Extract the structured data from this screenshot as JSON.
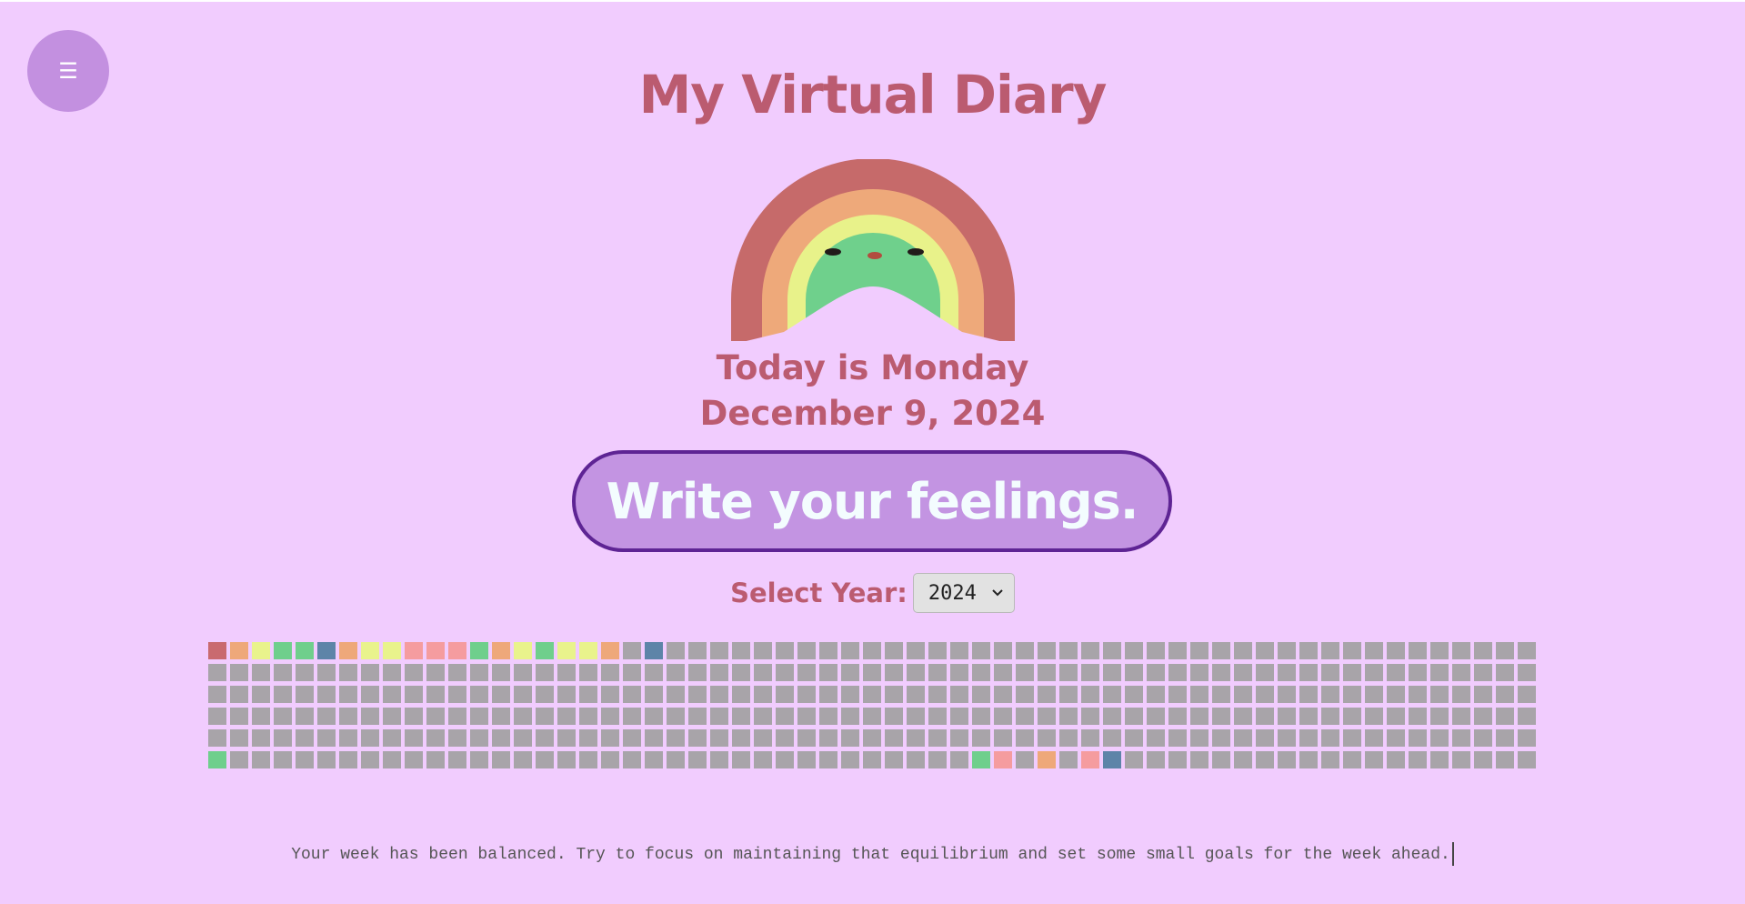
{
  "header": {
    "menu_label": "☰",
    "title": "My Virtual Diary"
  },
  "mascot": {
    "icon": "rainbow-face-icon"
  },
  "today": {
    "day_text": "Today is Monday",
    "date_text": "December 9, 2024"
  },
  "write_button_label": "Write your feelings.",
  "year_select": {
    "label": "Select Year:",
    "value": "2024"
  },
  "mood_grid": {
    "columns": 61,
    "total_days": 366,
    "colors": {
      "empty": "#a8a4a9",
      "red": "#c96a6f",
      "orange": "#eea87a",
      "yellow": "#e9f38c",
      "green": "#6fcf8c",
      "blue": "#5d84a8",
      "pink": "#f59c9f"
    },
    "filled_days": [
      [
        0,
        "red"
      ],
      [
        1,
        "orange"
      ],
      [
        2,
        "yellow"
      ],
      [
        3,
        "green"
      ],
      [
        4,
        "green"
      ],
      [
        5,
        "blue"
      ],
      [
        6,
        "orange"
      ],
      [
        7,
        "yellow"
      ],
      [
        8,
        "yellow"
      ],
      [
        9,
        "pink"
      ],
      [
        10,
        "pink"
      ],
      [
        11,
        "pink"
      ],
      [
        12,
        "green"
      ],
      [
        13,
        "orange"
      ],
      [
        14,
        "yellow"
      ],
      [
        15,
        "green"
      ],
      [
        16,
        "yellow"
      ],
      [
        17,
        "yellow"
      ],
      [
        18,
        "orange"
      ],
      [
        20,
        "blue"
      ],
      [
        305,
        "green"
      ],
      [
        340,
        "green"
      ],
      [
        341,
        "pink"
      ],
      [
        343,
        "orange"
      ],
      [
        345,
        "pink"
      ],
      [
        346,
        "blue"
      ]
    ]
  },
  "message": "Your week has been balanced. Try to focus on maintaining that equilibrium and set some small goals for the week ahead."
}
